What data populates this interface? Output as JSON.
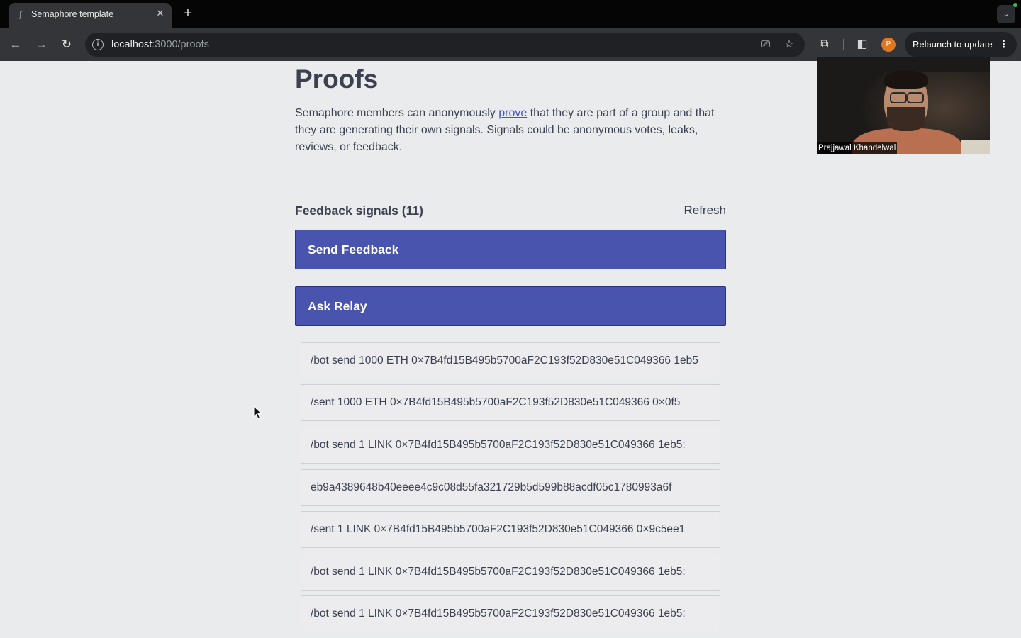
{
  "browser": {
    "tab_title": "Semaphore template",
    "tab_close": "✕",
    "new_tab": "+",
    "url_host": "localhost",
    "url_rest": ":3000/proofs",
    "profile_initial": "P",
    "relaunch_label": "Relaunch to update",
    "relaunch_menu": "⋮"
  },
  "page": {
    "title": "Proofs",
    "desc_before": "Semaphore members can anonymously ",
    "desc_link": "prove",
    "desc_after": " that they are part of a group and that they are generating their own signals. Signals could be anonymous votes, leaks, reviews, or feedback.",
    "signals_heading": "Feedback signals (11)",
    "refresh_label": "Refresh",
    "send_feedback_label": "Send Feedback",
    "ask_relay_label": "Ask Relay",
    "signals": [
      "/bot send 1000 ETH 0×7B4fd15B495b5700aF2C193f52D830e51C049366 1eb5",
      "/sent 1000 ETH 0×7B4fd15B495b5700aF2C193f52D830e51C049366 0×0f5",
      "/bot send 1 LINK 0×7B4fd15B495b5700aF2C193f52D830e51C049366 1eb5:",
      "eb9a4389648b40eeee4c9c08d55fa321729b5d599b88acdf05c1780993a6f",
      "/sent 1 LINK 0×7B4fd15B495b5700aF2C193f52D830e51C049366 0×9c5ee1",
      "/bot send 1 LINK 0×7B4fd15B495b5700aF2C193f52D830e51C049366 1eb5:",
      "/bot send 1 LINK 0×7B4fd15B495b5700aF2C193f52D830e51C049366 1eb5:"
    ]
  },
  "video": {
    "participant_name": "Prajjawal Khandelwal"
  },
  "colors": {
    "button_bg": "#4854ad",
    "link": "#3d55d6",
    "text": "#3b4151",
    "page_bg": "#eaebec"
  }
}
